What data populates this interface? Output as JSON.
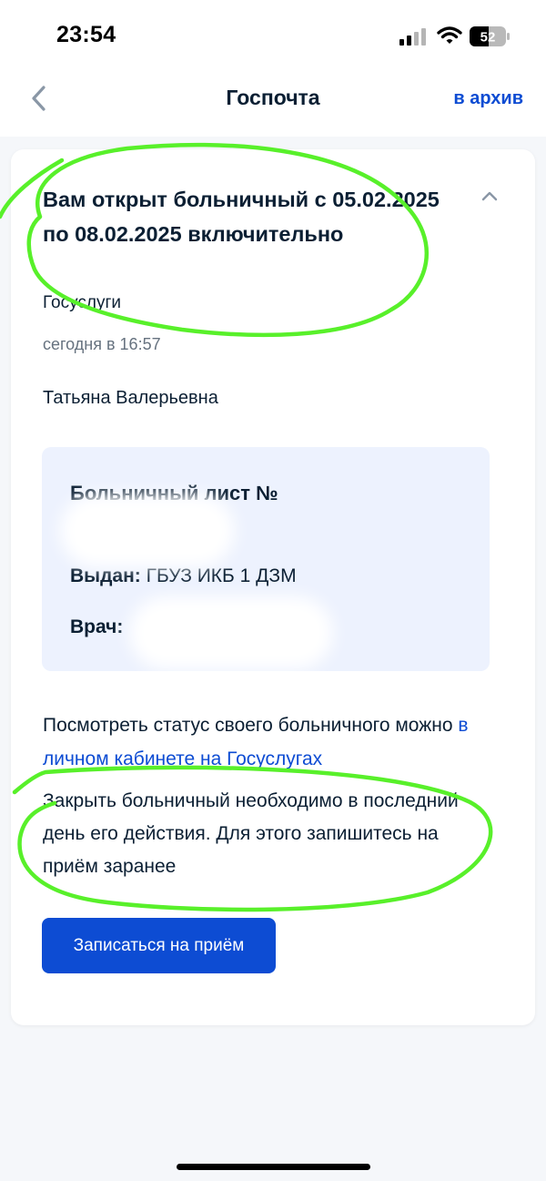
{
  "status_bar": {
    "time": "23:54",
    "battery_level": "52"
  },
  "nav": {
    "title": "Госпочта",
    "archive_label": "в архив"
  },
  "message": {
    "title": "Вам открыт больничный с 05.02.2025 по 08.02.2025 включительно",
    "sender": "Госуслуги",
    "timestamp": "сегодня в 16:57",
    "recipient": "Татьяна Валерьевна"
  },
  "document": {
    "title": "Больничный лист №",
    "issued_label": "Выдан:",
    "issued_value": "ГБУЗ ИКБ 1 ДЗМ",
    "doctor_label": "Врач:"
  },
  "status_info": {
    "text": "Посмотреть статус своего больничного можно ",
    "link": "в личном кабинете на Госуслугах"
  },
  "close_info": {
    "text": "Закрыть больничный необходимо в последний день его действия. Для этого запишитесь на приём заранее"
  },
  "actions": {
    "book_label": "Записаться на приём"
  },
  "colors": {
    "accent": "#0d4cd3",
    "doc_background": "#edf2fe",
    "annotation": "#58f02a"
  }
}
